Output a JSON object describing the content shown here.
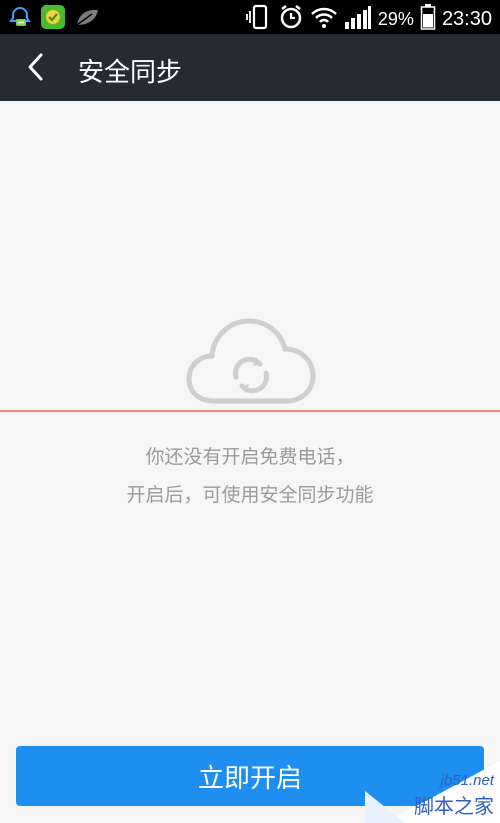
{
  "status_bar": {
    "battery": "29%",
    "time": "23:30"
  },
  "app_bar": {
    "title": "安全同步"
  },
  "content": {
    "message_line1": "你还没有开启免费电话，",
    "message_line2": "开启后，可使用安全同步功能",
    "primary_button": "立即开启"
  },
  "watermark": {
    "url": "jb51.net",
    "name": "脚本之家"
  },
  "colors": {
    "status_bar": "#000000",
    "app_bar": "#262a33",
    "background": "#f6f6f6",
    "accent": "#1e8ef0",
    "divider": "#f08a83",
    "message_text": "#9b9b9b"
  }
}
